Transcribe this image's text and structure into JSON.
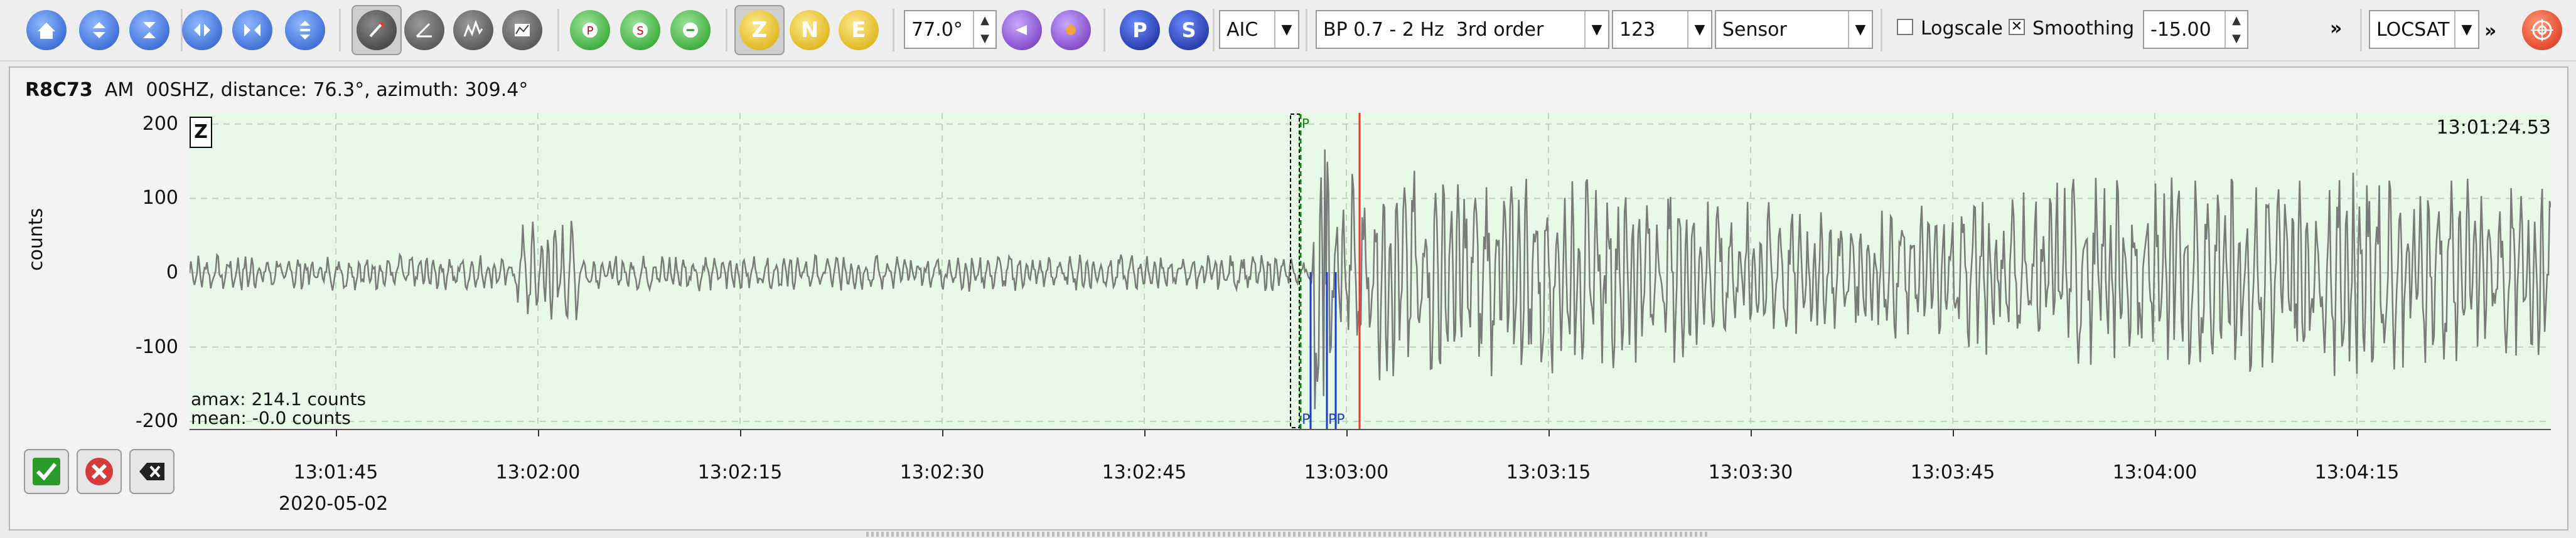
{
  "toolbar": {
    "scale_value": "77.0°",
    "component_buttons": [
      "Z",
      "N",
      "E"
    ],
    "phase_buttons": [
      "P",
      "S"
    ],
    "pick_type": "AIC",
    "filter": "BP 0.7 - 2 Hz  3rd order",
    "filter_num": "123",
    "unit_mode": "Sensor",
    "logscale_label": "Logscale",
    "logscale_checked": false,
    "smoothing_label": "Smoothing",
    "smoothing_checked": true,
    "smoothing_value": "-15.00",
    "overflow": "»",
    "locator": "LOCSAT",
    "overflow2": "»"
  },
  "trace": {
    "station": "R8C73",
    "net": "AM",
    "stream_info": "00SHZ, distance: 76.3°, azimuth: 309.4°",
    "component": "Z",
    "start_time": "13:01:24.53",
    "amax": "amax: 214.1 counts",
    "mean": "mean: -0.0 counts",
    "date": "2020-05-02",
    "ylabel": "counts"
  },
  "chart_data": {
    "type": "line",
    "yticks": [
      "200",
      "100",
      "0",
      "-100",
      "-200"
    ],
    "ylim": [
      -210,
      215
    ],
    "xticks": [
      "13:01:45",
      "13:02:00",
      "13:02:15",
      "13:02:30",
      "13:02:45",
      "13:03:00",
      "13:03:15",
      "13:03:30",
      "13:03:45",
      "13:04:00",
      "13:04:15"
    ],
    "picks": [
      {
        "label": "P",
        "time": "13:02:58"
      },
      {
        "label": "PP",
        "time": "13:02:59.8"
      }
    ],
    "grid": true,
    "colors": {
      "trace": "#7a7a7a",
      "grid": "#bcd8bc",
      "background": "#e8f9e8",
      "pick": "#1a40c0",
      "cursor": "#ff3030",
      "theoretical": "#0a8a0a"
    }
  }
}
